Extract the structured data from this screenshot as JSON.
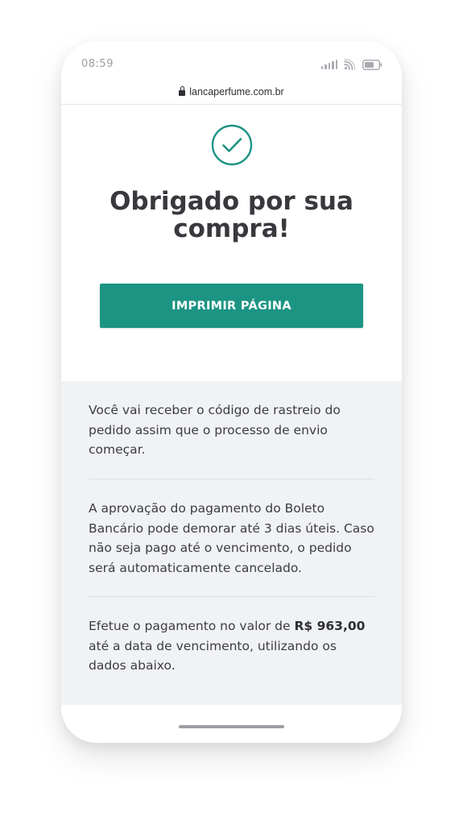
{
  "status_bar": {
    "time": "08:59",
    "icons": [
      "signal-icon",
      "wifi-icon",
      "battery-icon"
    ]
  },
  "browser": {
    "url": "lancaperfume.com.br",
    "secure_icon": "lock-icon"
  },
  "confirmation": {
    "icon": "check-circle-icon",
    "title": "Obrigado por sua compra!",
    "print_button_label": "IMPRIMIR PÁGINA"
  },
  "info": {
    "tracking_text": "Você vai receber o código de rastreio do pedido assim que o processo de envio começar.",
    "approval_text": "A aprovação do pagamento do Boleto Bancário pode demorar até 3 dias úteis. Caso não seja pago até o vencimento, o pedido será automaticamente cancelado.",
    "payment_text_before": "Efetue o pagamento no valor de ",
    "payment_amount": "R$ 963,00",
    "payment_text_after": " até a data de vencimento, utilizando os dados abaixo."
  },
  "colors": {
    "accent": "#1c9484",
    "title_text": "#37393d",
    "info_background": "#f1f2f4"
  }
}
